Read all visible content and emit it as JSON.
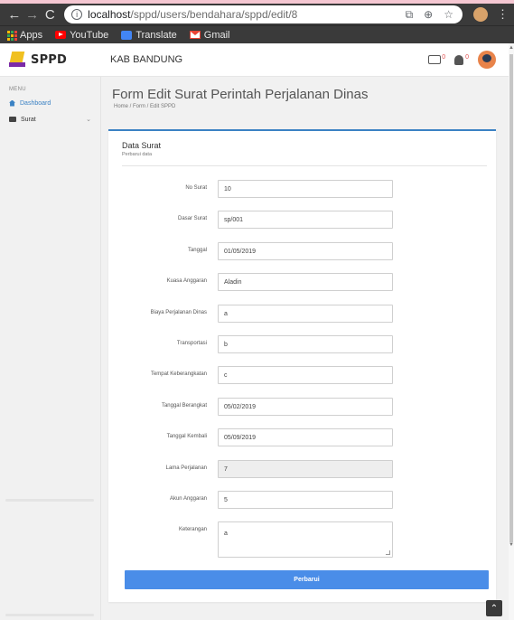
{
  "browser": {
    "url_host": "localhost",
    "url_path": "/sppd/users/bendahara/sppd/edit/8",
    "bookmarks": [
      {
        "label": "Apps"
      },
      {
        "label": "YouTube"
      },
      {
        "label": "Translate"
      },
      {
        "label": "Gmail"
      }
    ]
  },
  "header": {
    "logo_text": "SPPD",
    "title": "KAB BANDUNG",
    "message_badge": "0",
    "notification_badge": "0"
  },
  "sidebar": {
    "caption": "MENU",
    "items": [
      {
        "label": "Dashboard",
        "active": true
      },
      {
        "label": "Surat",
        "has_submenu": true
      }
    ]
  },
  "page": {
    "title": "Form Edit Surat Perintah Perjalanan Dinas",
    "breadcrumb": "Home / Form / Edit SPPD"
  },
  "card": {
    "title": "Data Surat",
    "subtitle": "Perbarui data",
    "accent_color": "#3b82c4"
  },
  "form": {
    "fields": [
      {
        "label": "No Surat",
        "value": "10"
      },
      {
        "label": "Dasar Surat",
        "value": "sp/001"
      },
      {
        "label": "Tanggal",
        "value": "01/05/2019"
      },
      {
        "label": "Kuasa Anggaran",
        "value": "Aladin"
      },
      {
        "label": "Biaya Perjalanan Dinas",
        "value": "a"
      },
      {
        "label": "Transportasi",
        "value": "b"
      },
      {
        "label": "Tempat Keberangkatan",
        "value": "c"
      },
      {
        "label": "Tanggal Berangkat",
        "value": "05/02/2019"
      },
      {
        "label": "Tanggal Kembali",
        "value": "05/09/2019"
      },
      {
        "label": "Lama Perjalanan",
        "value": "7",
        "disabled": true
      },
      {
        "label": "Akun Anggaran",
        "value": "5"
      },
      {
        "label": "Keterangan",
        "value": "a",
        "multiline": true
      }
    ],
    "submit_label": "Perbarui",
    "button_color": "#4a8de8"
  }
}
